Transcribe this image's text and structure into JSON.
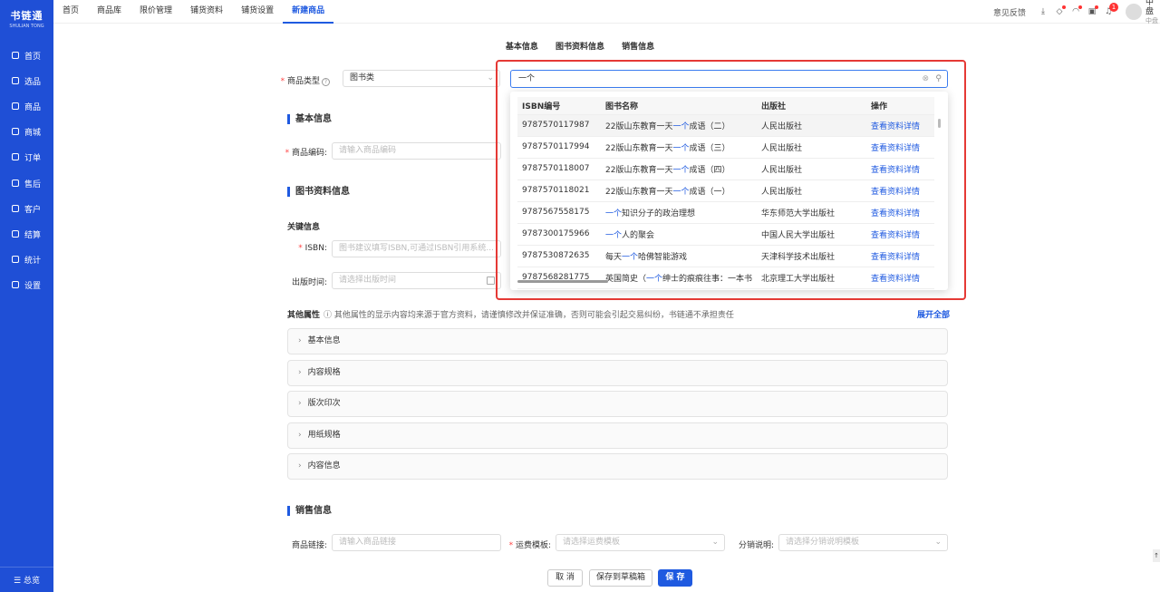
{
  "app": {
    "logo_text": "书链通",
    "logo_sub": "SHULIAN TONG"
  },
  "sidebar": {
    "items": [
      {
        "label": "首页",
        "icon": "monitor-icon"
      },
      {
        "label": "选品",
        "icon": "select-icon"
      },
      {
        "label": "商品",
        "icon": "goods-icon"
      },
      {
        "label": "商城",
        "icon": "mall-icon"
      },
      {
        "label": "订单",
        "icon": "order-icon"
      },
      {
        "label": "售后",
        "icon": "service-icon"
      },
      {
        "label": "客户",
        "icon": "customer-icon"
      },
      {
        "label": "结算",
        "icon": "settle-icon"
      },
      {
        "label": "统计",
        "icon": "stats-icon"
      },
      {
        "label": "设置",
        "icon": "settings-icon"
      }
    ],
    "bottom": "☰ 总览"
  },
  "topnav": {
    "tabs": [
      "首页",
      "商品库",
      "限价管理",
      "铺货资料",
      "铺货设置",
      "新建商品"
    ],
    "active": 5,
    "feedback": "意见反馈",
    "badge": "1",
    "user_name": "中盘",
    "user_sub": "中盘"
  },
  "section_tabs": [
    "基本信息",
    "图书资料信息",
    "销售信息"
  ],
  "form": {
    "type_label": "商品类型",
    "type_value": "图书类",
    "basic_title": "基本信息",
    "code_label": "商品编码",
    "code_placeholder": "请输入商品编码",
    "book_title": "图书资料信息",
    "key_info": "关键信息",
    "isbn_label": "ISBN",
    "isbn_placeholder": "图书建议填写ISBN,可通过ISBN引用系统...",
    "pubtime_label": "出版时间",
    "pubtime_placeholder": "请选择出版时间",
    "other_label": "其他属性",
    "other_hint": "ⓘ 其他属性的显示内容均来源于官方资料，请谨慎修改并保证准确，否则可能会引起交易纠纷，书链通不承担责任",
    "expand_all": "展开全部",
    "accordions": [
      "基本信息",
      "内容规格",
      "版次印次",
      "用纸规格",
      "内容信息"
    ],
    "sales_title": "销售信息",
    "link_label": "商品链接",
    "link_placeholder": "请输入商品链接",
    "freight_label": "运费模板",
    "freight_placeholder": "请选择运费模板",
    "dist_label": "分销说明",
    "dist_placeholder": "请选择分销说明模板"
  },
  "search": {
    "value": "一个",
    "columns": [
      "ISBN编号",
      "图书名称",
      "出版社",
      "操作"
    ],
    "rows": [
      {
        "isbn": "9787570117987",
        "pre": "22版山东教育一天",
        "hl": "一个",
        "post": "成语（二）",
        "publisher": "人民出版社",
        "action": "查看资料详情"
      },
      {
        "isbn": "9787570117994",
        "pre": "22版山东教育一天",
        "hl": "一个",
        "post": "成语（三）",
        "publisher": "人民出版社",
        "action": "查看资料详情"
      },
      {
        "isbn": "9787570118007",
        "pre": "22版山东教育一天",
        "hl": "一个",
        "post": "成语（四）",
        "publisher": "人民出版社",
        "action": "查看资料详情"
      },
      {
        "isbn": "9787570118021",
        "pre": "22版山东教育一天",
        "hl": "一个",
        "post": "成语（一）",
        "publisher": "人民出版社",
        "action": "查看资料详情"
      },
      {
        "isbn": "9787567558175",
        "pre": "",
        "hl": "一个",
        "post": "知识分子的政治理想",
        "publisher": "华东师范大学出版社",
        "action": "查看资料详情"
      },
      {
        "isbn": "9787300175966",
        "pre": "",
        "hl": "一个",
        "post": "人的聚会",
        "publisher": "中国人民大学出版社",
        "action": "查看资料详情"
      },
      {
        "isbn": "9787530872635",
        "pre": "每天",
        "hl": "一个",
        "post": "哈佛智能游戏",
        "publisher": "天津科学技术出版社",
        "action": "查看资料详情"
      },
      {
        "isbn": "9787568281775",
        "pre": "英国简史（",
        "hl": "一个",
        "post": "绅士的痕痕往事：一本书",
        "publisher": "北京理工大学出版社",
        "action": "查看资料详情"
      }
    ]
  },
  "buttons": {
    "cancel": "取 消",
    "draft": "保存到草稿箱",
    "save": "保 存"
  },
  "colors": {
    "brand": "#1f4fd6",
    "accent": "#1f5ae0",
    "highlight_box": "#e53935"
  }
}
